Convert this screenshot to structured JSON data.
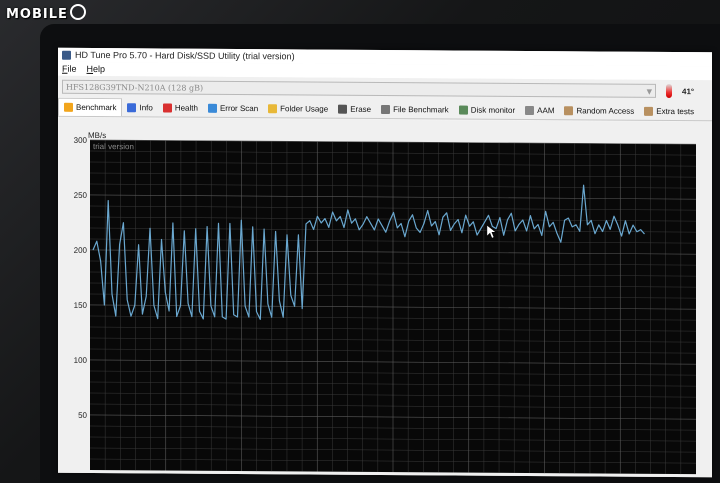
{
  "watermark": "MOBILE",
  "window": {
    "title": "HD Tune Pro 5.70 - Hard Disk/SSD Utility (trial version)"
  },
  "menu": {
    "file": "File",
    "help": "Help"
  },
  "drive": {
    "selected": "HFS128G39TND-N210A (128 gB)",
    "temperature": "41°"
  },
  "tabs": [
    {
      "label": "Benchmark",
      "icon": "benchmark-icon",
      "color": "#f2a51c"
    },
    {
      "label": "Info",
      "icon": "info-icon",
      "color": "#3a6ad8"
    },
    {
      "label": "Health",
      "icon": "health-icon",
      "color": "#d93030"
    },
    {
      "label": "Error Scan",
      "icon": "error-scan-icon",
      "color": "#3a8ad8"
    },
    {
      "label": "Folder Usage",
      "icon": "folder-icon",
      "color": "#e8b838"
    },
    {
      "label": "Erase",
      "icon": "erase-icon",
      "color": "#555555"
    },
    {
      "label": "File Benchmark",
      "icon": "file-benchmark-icon",
      "color": "#777777"
    },
    {
      "label": "Disk monitor",
      "icon": "disk-monitor-icon",
      "color": "#5a8a5a"
    },
    {
      "label": "AAM",
      "icon": "speaker-icon",
      "color": "#888888"
    },
    {
      "label": "Random Access",
      "icon": "random-access-icon",
      "color": "#b89060"
    },
    {
      "label": "Extra tests",
      "icon": "extra-tests-icon",
      "color": "#b89060"
    }
  ],
  "chart_data": {
    "type": "line",
    "ylabel": "MB/s",
    "watermark": "trial version",
    "ylim": [
      0,
      300
    ],
    "yticks": [
      50,
      100,
      150,
      200,
      250,
      300
    ],
    "grid": true,
    "series": [
      {
        "color": "#6aa8d0",
        "values": [
          200,
          208,
          190,
          150,
          245,
          160,
          140,
          205,
          225,
          155,
          140,
          150,
          205,
          142,
          158,
          220,
          150,
          138,
          210,
          162,
          145,
          225,
          140,
          150,
          218,
          152,
          140,
          220,
          145,
          138,
          222,
          150,
          140,
          225,
          140,
          138,
          225,
          142,
          140,
          228,
          150,
          140,
          222,
          145,
          138,
          220,
          152,
          140,
          218,
          155,
          140,
          215,
          160,
          150,
          215,
          148,
          225,
          228,
          220,
          232,
          226,
          230,
          222,
          236,
          228,
          232,
          222,
          238,
          226,
          230,
          220,
          225,
          232,
          226,
          220,
          230,
          224,
          218,
          228,
          236,
          222,
          226,
          214,
          228,
          234,
          222,
          218,
          226,
          238,
          224,
          228,
          216,
          232,
          236,
          220,
          226,
          230,
          218,
          234,
          224,
          228,
          216,
          222,
          228,
          234,
          224,
          222,
          232,
          216,
          230,
          236,
          220,
          226,
          230,
          220,
          234,
          222,
          226,
          216,
          238,
          224,
          228,
          218,
          210,
          230,
          232,
          224,
          226,
          220,
          262,
          226,
          230,
          218,
          226,
          220,
          230,
          222,
          234,
          226,
          216,
          230,
          218,
          226,
          220,
          222,
          218
        ]
      }
    ]
  }
}
